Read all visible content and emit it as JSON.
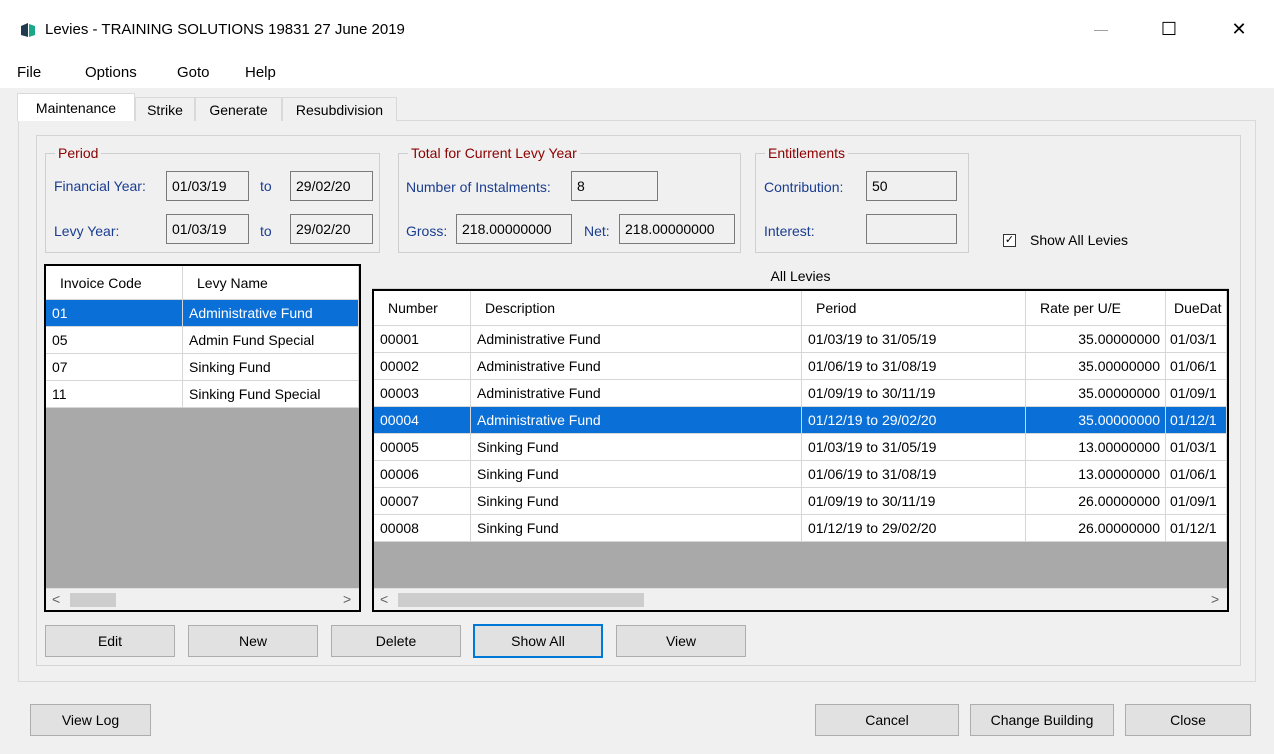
{
  "window": {
    "title": "Levies - TRAINING SOLUTIONS 19831 27 June 2019",
    "minimize": "—",
    "maximize": "☐",
    "close": "✕"
  },
  "menu": [
    "File",
    "Options",
    "Goto",
    "Help"
  ],
  "tabs": [
    "Maintenance",
    "Strike",
    "Generate",
    "Resubdivision"
  ],
  "period": {
    "title": "Period",
    "financial_year_label": "Financial Year:",
    "financial_from": "01/03/19",
    "to1": "to",
    "financial_to": "29/02/20",
    "levy_year_label": "Levy Year:",
    "levy_from": "01/03/19",
    "to2": "to",
    "levy_to": "29/02/20"
  },
  "totals": {
    "title": "Total for Current Levy Year",
    "instalments_label": "Number of Instalments:",
    "instalments": "8",
    "gross_label": "Gross:",
    "gross": "218.00000000",
    "net_label": "Net:",
    "net": "218.00000000"
  },
  "entitlements": {
    "title": "Entitlements",
    "contribution_label": "Contribution:",
    "contribution": "50",
    "interest_label": "Interest:",
    "interest": ""
  },
  "show_all_levies": {
    "label": "Show All Levies",
    "checked": "✓"
  },
  "levy_codes": {
    "headers": [
      "Invoice Code",
      "Levy Name"
    ],
    "rows": [
      [
        "01",
        "Administrative Fund"
      ],
      [
        "05",
        "Admin Fund Special"
      ],
      [
        "07",
        "Sinking Fund"
      ],
      [
        "11",
        "Sinking Fund Special"
      ]
    ]
  },
  "all_levies": {
    "caption": "All Levies",
    "headers": [
      "Number",
      "Description",
      "Period",
      "Rate per U/E",
      "DueDat"
    ],
    "rows": [
      [
        "00001",
        "Administrative Fund",
        "01/03/19 to 31/05/19",
        "35.00000000",
        "01/03/1"
      ],
      [
        "00002",
        "Administrative Fund",
        "01/06/19 to 31/08/19",
        "35.00000000",
        "01/06/1"
      ],
      [
        "00003",
        "Administrative Fund",
        "01/09/19 to 30/11/19",
        "35.00000000",
        "01/09/1"
      ],
      [
        "00004",
        "Administrative Fund",
        "01/12/19 to 29/02/20",
        "35.00000000",
        "01/12/1"
      ],
      [
        "00005",
        "Sinking Fund",
        "01/03/19 to 31/05/19",
        "13.00000000",
        "01/03/1"
      ],
      [
        "00006",
        "Sinking Fund",
        "01/06/19 to 31/08/19",
        "13.00000000",
        "01/06/1"
      ],
      [
        "00007",
        "Sinking Fund",
        "01/09/19 to 30/11/19",
        "26.00000000",
        "01/09/1"
      ],
      [
        "00008",
        "Sinking Fund",
        "01/12/19 to 29/02/20",
        "26.00000000",
        "01/12/1"
      ]
    ]
  },
  "scroll": {
    "left": "<",
    "right": ">"
  },
  "actions": [
    "Edit",
    "New",
    "Delete",
    "Show All",
    "View"
  ],
  "footer": {
    "view_log": "View Log",
    "cancel": "Cancel",
    "change_building": "Change Building",
    "close": "Close"
  }
}
